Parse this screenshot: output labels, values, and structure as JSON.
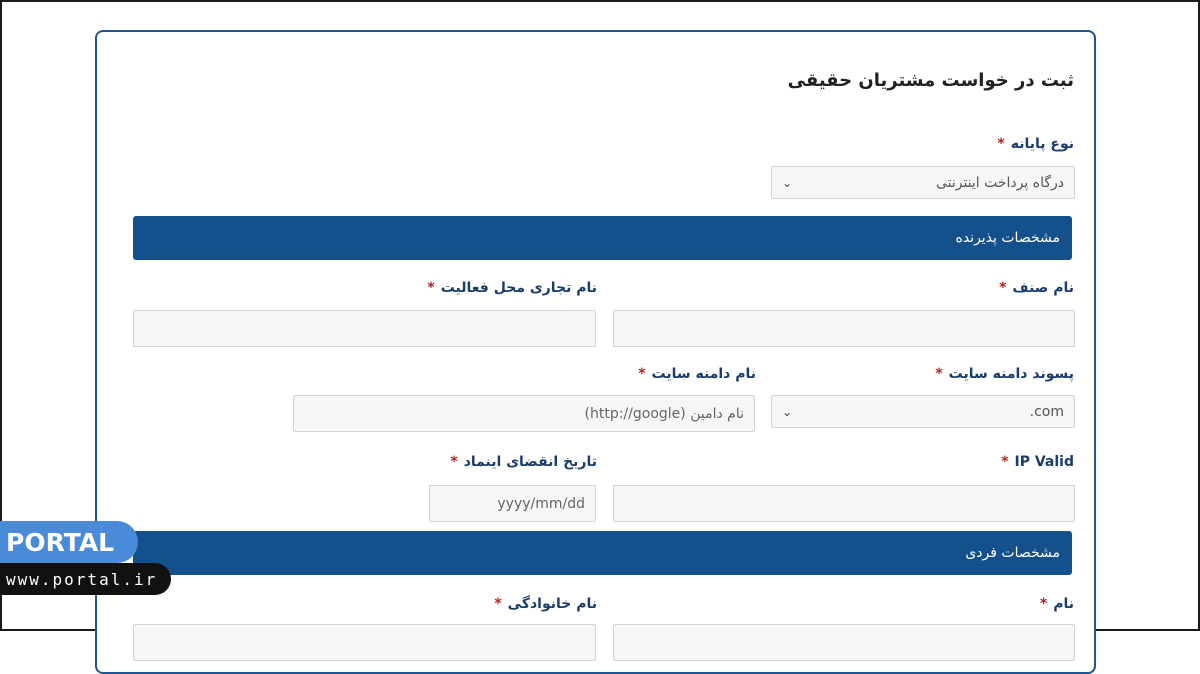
{
  "form": {
    "title": "ثبت در خواست مشتریان حقیقی",
    "terminal_type_label": "نوع پایانه",
    "terminal_type_value": "درگاه پرداخت اینترنتی",
    "section_acceptor": "مشخصات پذیرنده",
    "guild_name_label": "نام صنف",
    "business_name_label": "نام تجاری محل فعالیت",
    "domain_suffix_label": "پسوند دامنه سایت",
    "domain_suffix_value": ".com",
    "site_domain_label": "نام دامنه سایت",
    "site_domain_placeholder": "نام دامین (http://google)",
    "ip_valid_label": "IP Valid",
    "enamad_expiry_label": "تاریخ انقضای اینماد",
    "enamad_expiry_placeholder": "yyyy/mm/dd",
    "section_personal": "مشخصات فردی",
    "first_name_label": "نام",
    "last_name_label": "نام خانوادگی",
    "required_mark": "*"
  },
  "watermark": {
    "brand": "PORTAL",
    "url": "www.portal.ir"
  },
  "colors": {
    "primary": "#14508c",
    "label": "#1a3d6e",
    "required": "#b22222"
  }
}
